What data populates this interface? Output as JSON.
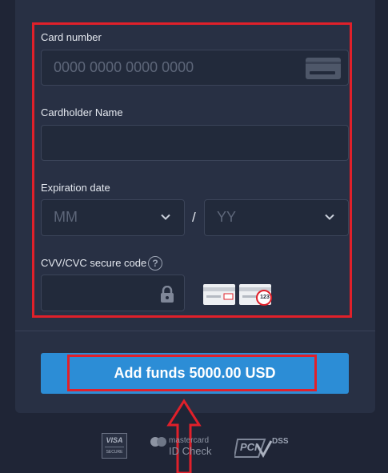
{
  "form": {
    "card_number_label": "Card number",
    "card_number_placeholder": "0000 0000 0000 0000",
    "cardholder_label": "Cardholder Name",
    "cardholder_value": "",
    "expiration_label": "Expiration date",
    "month_placeholder": "MM",
    "year_placeholder": "YY",
    "separator": "/",
    "cvv_label": "CVV/CVC secure code",
    "cvv_help_glyph": "?",
    "cvv_example": "123"
  },
  "action": {
    "submit_label": "Add funds 5000.00 USD"
  },
  "footer": {
    "visa_text": "VISA",
    "visa_sub": "SECURE",
    "mastercard_text": "mastercard",
    "mastercard_sub": "ID Check",
    "pci_text": "PCI",
    "pci_sub": "DSS"
  },
  "colors": {
    "page_bg": "#1f2536",
    "card_bg": "#283044",
    "highlight": "#e0202a",
    "button": "#2c8dd6"
  }
}
